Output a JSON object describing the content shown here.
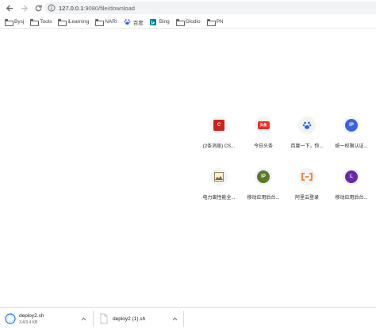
{
  "browser": {
    "url_host": "127.0.0.1",
    "url_path": ":9080/file/download"
  },
  "bookmarks": [
    {
      "label": "Bysj",
      "icon": "folder-icon"
    },
    {
      "label": "Tools",
      "icon": "folder-icon"
    },
    {
      "label": "iLearning",
      "icon": "folder-icon"
    },
    {
      "label": "NARI",
      "icon": "folder-icon"
    },
    {
      "label": "百度",
      "icon": "baidu-icon"
    },
    {
      "label": "Bing",
      "icon": "bing-icon"
    },
    {
      "label": "Glodio",
      "icon": "folder-icon"
    },
    {
      "label": "PN",
      "icon": "folder-icon"
    }
  ],
  "shortcuts": [
    {
      "label": "(2条消息) CS...",
      "icon": "csdn-icon",
      "badge": "C",
      "color": "#c8231f"
    },
    {
      "label": "今日头条",
      "icon": "toutiao-icon",
      "badge": "头条",
      "color": "#e8322b"
    },
    {
      "label": "百度一下，你...",
      "icon": "baidu-paw-icon",
      "badge": "",
      "color": "#2f62e6"
    },
    {
      "label": "统一权限认证...",
      "icon": "ip-icon",
      "badge": "IP",
      "color": "#3b63d8"
    },
    {
      "label": "电力离性能全...",
      "icon": "image-icon",
      "badge": "",
      "color": "#7a6a3a"
    },
    {
      "label": "移动应用后台...",
      "icon": "ip-icon",
      "badge": "IP",
      "color": "#5a7a2a"
    },
    {
      "label": "阿里云登录",
      "icon": "aliyun-icon",
      "badge": "",
      "color": "#ff6a00"
    },
    {
      "label": "移动应用后台...",
      "icon": "l-icon",
      "badge": "L",
      "color": "#6a2aa8"
    }
  ],
  "downloads": [
    {
      "name": "deploy2.sh",
      "size": "3.4/3.4 KB",
      "status": "in-progress"
    },
    {
      "name": "deploy2 (1).sh",
      "size": "",
      "status": "complete"
    }
  ]
}
